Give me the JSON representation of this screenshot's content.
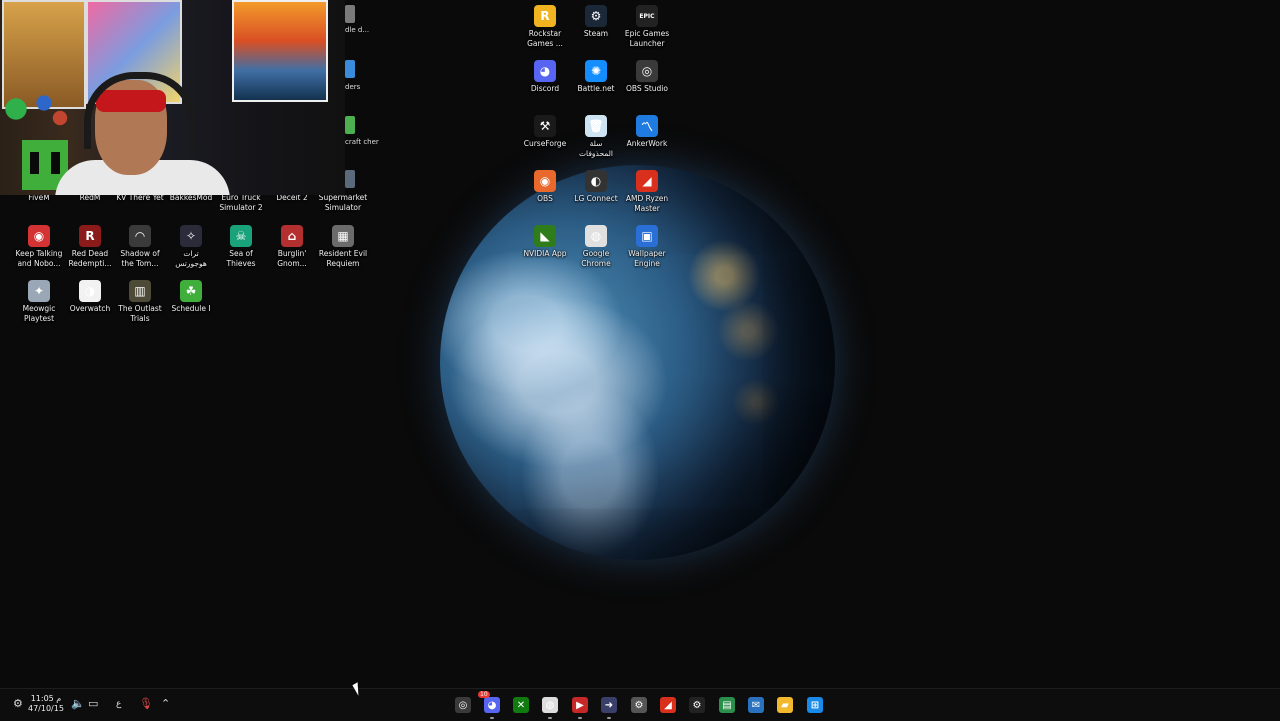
{
  "desktop": {
    "wallpaper": "earth-at-night",
    "top_icons": [
      {
        "label": "Rockstar\nGames ...",
        "icon": "rockstar-icon",
        "color": "#f2b320",
        "glyph": "R"
      },
      {
        "label": "Steam",
        "icon": "steam-icon",
        "color": "#1b2838",
        "glyph": "⚙"
      },
      {
        "label": "Epic Games\nLauncher",
        "icon": "epic-games-icon",
        "color": "#222222",
        "glyph": "EPIC"
      },
      {
        "label": "Discord",
        "icon": "discord-icon",
        "color": "#5865f2",
        "glyph": "◕"
      },
      {
        "label": "Battle.net",
        "icon": "battlenet-icon",
        "color": "#148eff",
        "glyph": "✺"
      },
      {
        "label": "OBS Studio",
        "icon": "obs-icon",
        "color": "#3a3a3a",
        "glyph": "◎"
      },
      {
        "label": "CurseForge",
        "icon": "curseforge-icon",
        "color": "#1a1a1a",
        "glyph": "⚒"
      },
      {
        "label": "سلة\nالمحذوفات",
        "icon": "recycle-bin-icon",
        "color": "#cfe4f2",
        "glyph": "🗑"
      },
      {
        "label": "AnkerWork",
        "icon": "ankerwork-icon",
        "color": "#1f7be0",
        "glyph": "〽"
      },
      {
        "label": "OBS",
        "icon": "obs-orange-icon",
        "color": "#e8692b",
        "glyph": "◉"
      },
      {
        "label": "LG Connect",
        "icon": "lg-connect-icon",
        "color": "#333333",
        "glyph": "◐"
      },
      {
        "label": "AMD Ryzen\nMaster",
        "icon": "amd-ryzen-icon",
        "color": "#d8301c",
        "glyph": "◢"
      },
      {
        "label": "NVIDIA App",
        "icon": "nvidia-icon",
        "color": "#2e7d1a",
        "glyph": "◣"
      },
      {
        "label": "Google\nChrome",
        "icon": "chrome-icon",
        "color": "#e0e0e0",
        "glyph": "◍"
      },
      {
        "label": "Wallpaper\nEngine",
        "icon": "wallpaper-engine-icon",
        "color": "#2a6fd6",
        "glyph": "▣"
      }
    ],
    "row1_labels": [
      "FiveM",
      "RedM",
      "KV There Yet",
      "BakkesMod",
      "Euro Truck\nSimulator 2",
      "Deceit 2",
      "Supermarket\nSimulator"
    ],
    "left_icons": [
      {
        "label": "Keep Talking\nand Nobo...",
        "icon": "keep-talking-icon",
        "color": "#d33333",
        "glyph": "◉"
      },
      {
        "label": "Red Dead\nRedempti...",
        "icon": "red-dead-icon",
        "color": "#8b1a1a",
        "glyph": "R"
      },
      {
        "label": "Shadow of\nthe Tom...",
        "icon": "shadow-tomb-raider-icon",
        "color": "#3a3a3a",
        "glyph": "◠"
      },
      {
        "label": "ترات\nهوجورتس",
        "icon": "hogwarts-icon",
        "color": "#2b2b3a",
        "glyph": "✧"
      },
      {
        "label": "Sea of\nThieves",
        "icon": "sea-of-thieves-icon",
        "color": "#1aa37a",
        "glyph": "☠"
      },
      {
        "label": "Burglin'\nGnom...",
        "icon": "burglin-gnomes-icon",
        "color": "#b43030",
        "glyph": "⌂"
      },
      {
        "label": "Resident Evil\nRequiem",
        "icon": "resident-evil-icon",
        "color": "#6b6b6b",
        "glyph": "▦"
      },
      {
        "label": "Meowgic\nPlaytest",
        "icon": "meowgic-icon",
        "color": "#9aa7b6",
        "glyph": "✦"
      },
      {
        "label": "Overwatch",
        "icon": "overwatch-icon",
        "color": "#f2f2f2",
        "glyph": "◑"
      },
      {
        "label": "The Outlast\nTrials",
        "icon": "outlast-trials-icon",
        "color": "#4e4a38",
        "glyph": "▥"
      },
      {
        "label": "Schedule I",
        "icon": "schedule-one-icon",
        "color": "#3fae3a",
        "glyph": "☘"
      }
    ],
    "partial_labels": [
      "dle\nd...",
      "ders",
      "craft\ncher"
    ]
  },
  "taskbar": {
    "clock_time": "11:05 م",
    "clock_date": "47/10/15",
    "lang": "ع",
    "tray_icons": [
      "settings-icon",
      "volume-icon",
      "display-icon",
      "mic-icon",
      "chevron-up-icon"
    ],
    "pinned": [
      {
        "icon": "obs-taskbar-icon",
        "color": "#3a3a3a",
        "glyph": "◎"
      },
      {
        "icon": "discord-taskbar-icon",
        "color": "#5865f2",
        "glyph": "◕",
        "badge": "10"
      },
      {
        "icon": "xbox-icon",
        "color": "#107c10",
        "glyph": "✕"
      },
      {
        "icon": "chrome-taskbar-icon",
        "color": "#dddddd",
        "glyph": "◍"
      },
      {
        "icon": "media-app-icon",
        "color": "#c62828",
        "glyph": "▶"
      },
      {
        "icon": "arrow-app-icon",
        "color": "#3a3f6a",
        "glyph": "➜"
      },
      {
        "icon": "settings-taskbar-icon",
        "color": "#555555",
        "glyph": "⚙"
      },
      {
        "icon": "amd-taskbar-icon",
        "color": "#d8301c",
        "glyph": "◢"
      },
      {
        "icon": "steam-taskbar-icon",
        "color": "#222222",
        "glyph": "⚙"
      },
      {
        "icon": "store-icon",
        "color": "#2a8f4a",
        "glyph": "▤"
      },
      {
        "icon": "mail-icon",
        "color": "#2a72c0",
        "glyph": "✉"
      },
      {
        "icon": "file-explorer-icon",
        "color": "#f2b82e",
        "glyph": "▰"
      },
      {
        "icon": "start-icon",
        "color": "#1a8ae8",
        "glyph": "⊞"
      }
    ]
  }
}
